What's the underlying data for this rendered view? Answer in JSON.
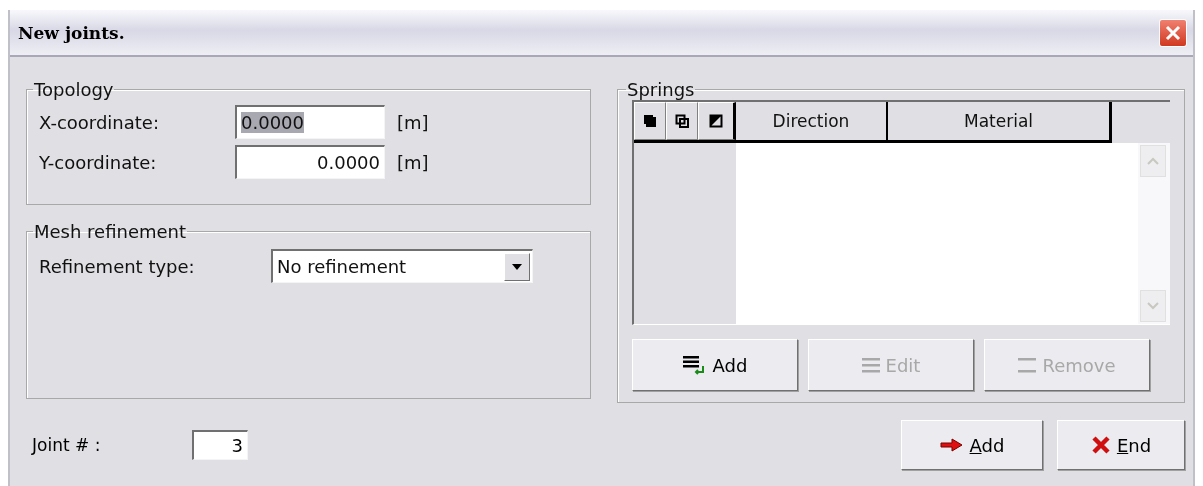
{
  "window": {
    "title": "New joints."
  },
  "topology": {
    "title": "Topology",
    "fields": [
      {
        "label": "X-coordinate:",
        "value": "0.0000",
        "unit": "[m]",
        "selected": true
      },
      {
        "label": "Y-coordinate:",
        "value": "0.0000",
        "unit": "[m]",
        "selected": false
      }
    ]
  },
  "mesh_refinement": {
    "title": "Mesh refinement",
    "label": "Refinement type:",
    "value": "No refinement"
  },
  "springs": {
    "title": "Springs",
    "columns": [
      "Direction",
      "Material"
    ],
    "buttons": [
      {
        "label": "Add",
        "kind": "add",
        "disabled": false
      },
      {
        "label": "Edit",
        "kind": "edit",
        "disabled": true
      },
      {
        "label": "Remove",
        "kind": "remove",
        "disabled": true
      }
    ]
  },
  "joint": {
    "label": "Joint # :",
    "value": "3"
  },
  "buttons": [
    {
      "label": "Add",
      "kind": "add",
      "mnemonic": true
    },
    {
      "label": "End",
      "kind": "end",
      "mnemonic": true
    }
  ]
}
